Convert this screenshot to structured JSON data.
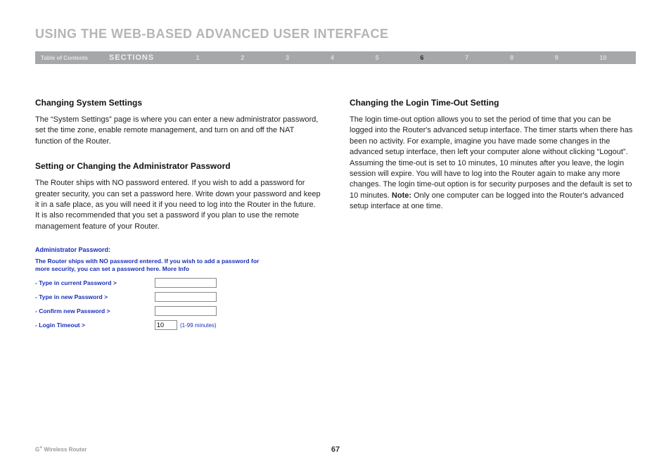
{
  "header": {
    "title": "USING THE WEB-BASED ADVANCED USER INTERFACE"
  },
  "nav": {
    "toc": "Table of Contents",
    "sections_label": "SECTIONS",
    "numbers": [
      "1",
      "2",
      "3",
      "4",
      "5",
      "6",
      "7",
      "8",
      "9",
      "10"
    ],
    "active": "6"
  },
  "left": {
    "h1": "Changing System Settings",
    "p1": "The “System Settings” page is where you can enter a new administrator password, set the time zone, enable remote management, and turn on and off the NAT function of the Router.",
    "h2": "Setting or Changing the Administrator Password",
    "p2": "The Router ships with NO password entered. If you wish to add a password for greater security, you can set a password here. Write down your password and keep it in a safe place, as you will need it if you need to log into the Router in the future. It is also recommended that you set a password if you plan to use the remote management feature of your Router."
  },
  "adminForm": {
    "heading": "Administrator Password:",
    "desc_prefix": "The Router ships with NO password entered. If you wish to add a password for more security, you can set a password here. ",
    "more": "More Info",
    "row_current": "Type in current Password >",
    "row_new": "Type in new Password >",
    "row_confirm": "Confirm new Password >",
    "row_timeout": "Login Timeout >",
    "timeout_value": "10",
    "timeout_hint": "(1-99 minutes)"
  },
  "right": {
    "h1": "Changing the Login Time-Out Setting",
    "p1_prefix": "The login time-out option allows you to set the period of time that you can be logged into the Router's advanced setup interface. The timer starts when there has been no activity. For example, imagine you have made some changes in the advanced setup interface, then left your computer alone without clicking “Logout”. Assuming the time-out is set to 10 minutes, 10 minutes after you leave, the login session will expire. You will have to log into the Router again to make any more changes. The login time-out option is for security purposes and the default is set to 10 minutes. ",
    "note_label": "Note:",
    "p1_suffix": " Only one computer can be logged into the Router's advanced setup interface at one time."
  },
  "footer": {
    "product": "G+ Wireless Router",
    "page": "67"
  }
}
